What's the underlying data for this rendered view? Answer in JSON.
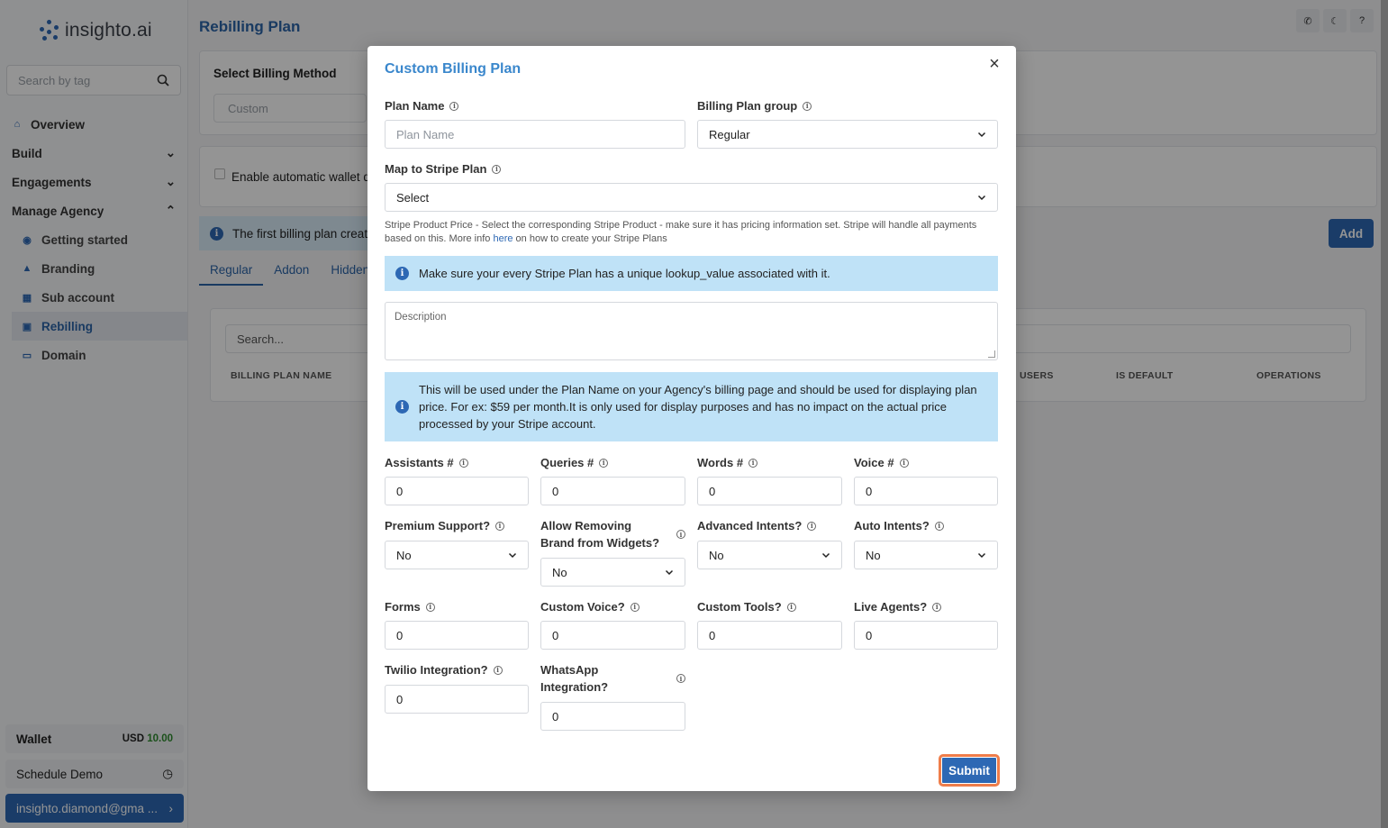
{
  "app": {
    "logo_text": "insighto.ai",
    "search_placeholder": "Search by tag",
    "nav": {
      "overview": "Overview",
      "build": "Build",
      "engagements": "Engagements",
      "manage_agency": "Manage Agency",
      "getting_started": "Getting started",
      "branding": "Branding",
      "sub_account": "Sub account",
      "rebilling": "Rebilling",
      "domain": "Domain"
    },
    "wallet_label": "Wallet",
    "wallet_currency": "USD",
    "wallet_amount": "10.00",
    "schedule_demo": "Schedule Demo",
    "user_email": "insighto.diamond@gma ..."
  },
  "page": {
    "title": "Rebilling Plan",
    "billing_method_label": "Select Billing Method",
    "billing_method_value": "Custom",
    "wallet_toggle_text": "Enable automatic wallet de",
    "banner_text": "The first billing plan create",
    "add_button": "Add",
    "tabs": [
      "Regular",
      "Addon",
      "Hidden"
    ],
    "table_search_placeholder": "Search...",
    "columns": {
      "name": "BILLING PLAN NAME",
      "users": "USERS",
      "is_default": "IS DEFAULT",
      "operations": "OPERATIONS"
    }
  },
  "modal": {
    "title": "Custom Billing Plan",
    "plan_name_label": "Plan Name",
    "plan_name_placeholder": "Plan Name",
    "group_label": "Billing Plan group",
    "group_value": "Regular",
    "stripe_label": "Map to Stripe Plan",
    "stripe_value": "Select",
    "helper_text_a": "Stripe Product Price - Select the corresponding Stripe Product - make sure it has pricing information set. Stripe will handle all payments based on this. More info ",
    "helper_link": "here",
    "helper_text_b": " on how to create your Stripe Plans",
    "alert_lookup": "Make sure your every Stripe Plan has a unique lookup_value associated with it.",
    "description_placeholder": "Description",
    "alert_description": "This will be used under the Plan Name on your Agency's billing page and should be used for displaying plan price. For ex: $59 per month.It is only used for display purposes and has no impact on the actual price processed by your Stripe account.",
    "fields": {
      "assistants": {
        "label": "Assistants #",
        "value": "0"
      },
      "queries": {
        "label": "Queries #",
        "value": "0"
      },
      "words": {
        "label": "Words #",
        "value": "0"
      },
      "voice": {
        "label": "Voice #",
        "value": "0"
      },
      "premium_support": {
        "label": "Premium Support?",
        "value": "No"
      },
      "remove_brand": {
        "label": "Allow Removing Brand from Widgets?",
        "value": "No"
      },
      "advanced_intents": {
        "label": "Advanced Intents?",
        "value": "No"
      },
      "auto_intents": {
        "label": "Auto Intents?",
        "value": "No"
      },
      "forms": {
        "label": "Forms",
        "value": "0"
      },
      "custom_voice": {
        "label": "Custom Voice?",
        "value": "0"
      },
      "custom_tools": {
        "label": "Custom Tools?",
        "value": "0"
      },
      "live_agents": {
        "label": "Live Agents?",
        "value": "0"
      },
      "twilio": {
        "label": "Twilio Integration?",
        "value": "0"
      },
      "whatsapp": {
        "label": "WhatsApp Integration?",
        "value": "0"
      }
    },
    "submit_label": "Submit"
  },
  "colors": {
    "primary": "#2d68b4",
    "title_blue": "#3a87cc",
    "alert_bg": "#bfe2f7",
    "submit_focus": "#ef7d4a"
  }
}
